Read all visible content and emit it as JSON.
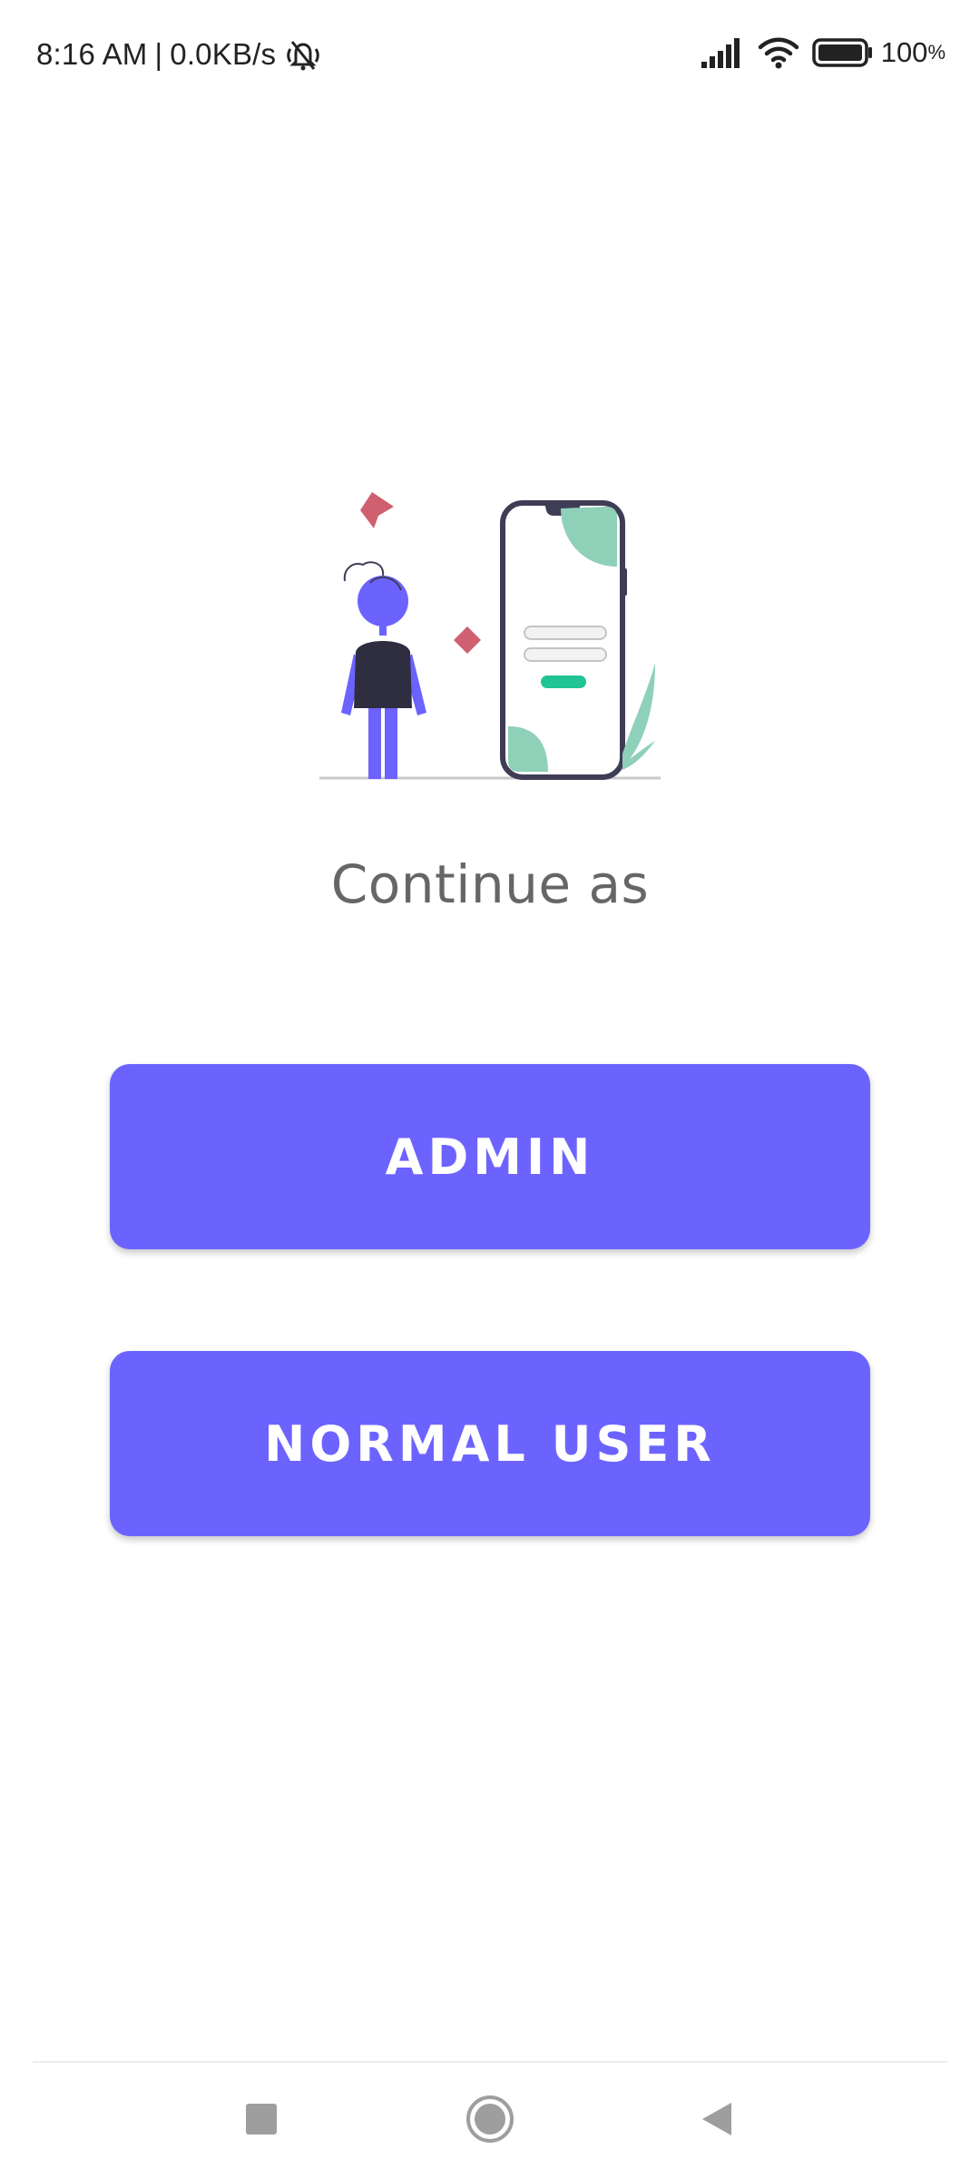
{
  "status_bar": {
    "time": "8:16 AM",
    "separator": "|",
    "network_speed": "0.0KB/s",
    "battery_percent": "100",
    "battery_unit": "%",
    "icons": [
      "mute-icon",
      "signal-icon",
      "wifi-icon",
      "battery-icon"
    ]
  },
  "main": {
    "illustration": "login-illustration",
    "prompt": "Continue as",
    "admin_label": "ADMIN",
    "user_label": "NORMAL USER"
  },
  "nav_bar": {
    "icons": [
      "recents-icon",
      "home-icon",
      "back-icon"
    ]
  },
  "colors": {
    "accent": "#6c63ff",
    "button_text": "#ffffff",
    "prompt_text": "#666666",
    "illustration_red": "#d05f6f",
    "illustration_green": "#8fd0b9",
    "illustration_dark": "#3f3d56"
  }
}
